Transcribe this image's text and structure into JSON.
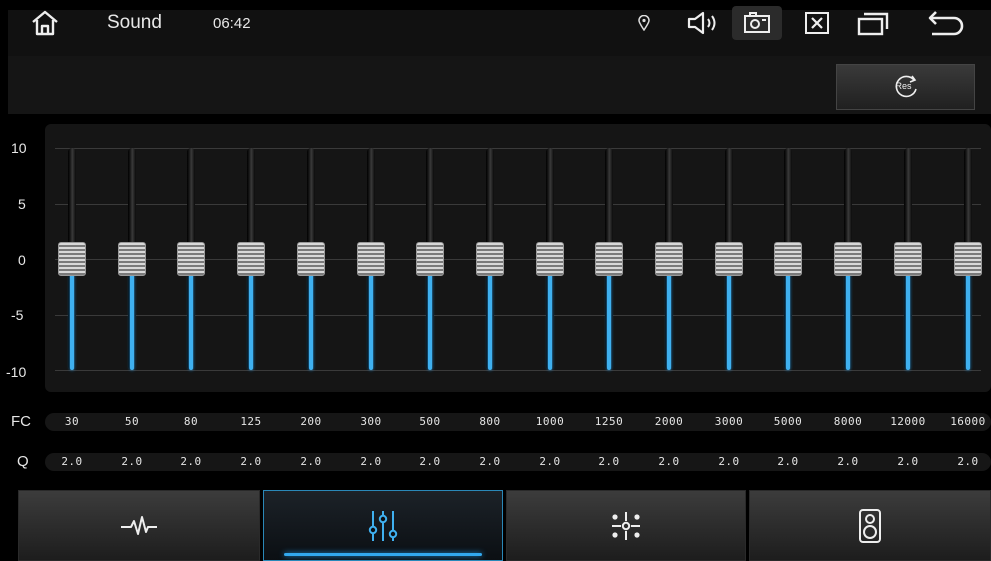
{
  "topbar": {
    "title": "Sound",
    "time": "06:42",
    "icons": [
      "home-icon",
      "location-icon",
      "volume-icon",
      "screenshot-camera-icon",
      "close-box-icon",
      "window-icon",
      "back-arrow-icon"
    ]
  },
  "reset": {
    "label": "Res",
    "icon": "reset-icon"
  },
  "eq": {
    "y_labels": [
      "10",
      "5",
      "0",
      "-5",
      "-10"
    ],
    "fc_label": "FC",
    "q_label": "Q",
    "bands": [
      {
        "fc": "30",
        "q": "2.0",
        "gain": 0
      },
      {
        "fc": "50",
        "q": "2.0",
        "gain": 0
      },
      {
        "fc": "80",
        "q": "2.0",
        "gain": 0
      },
      {
        "fc": "125",
        "q": "2.0",
        "gain": 0
      },
      {
        "fc": "200",
        "q": "2.0",
        "gain": 0
      },
      {
        "fc": "300",
        "q": "2.0",
        "gain": 0
      },
      {
        "fc": "500",
        "q": "2.0",
        "gain": 0
      },
      {
        "fc": "800",
        "q": "2.0",
        "gain": 0
      },
      {
        "fc": "1000",
        "q": "2.0",
        "gain": 0
      },
      {
        "fc": "1250",
        "q": "2.0",
        "gain": 0
      },
      {
        "fc": "2000",
        "q": "2.0",
        "gain": 0
      },
      {
        "fc": "3000",
        "q": "2.0",
        "gain": 0
      },
      {
        "fc": "5000",
        "q": "2.0",
        "gain": 0
      },
      {
        "fc": "8000",
        "q": "2.0",
        "gain": 0
      },
      {
        "fc": "12000",
        "q": "2.0",
        "gain": 0
      },
      {
        "fc": "16000",
        "q": "2.0",
        "gain": 0
      }
    ]
  },
  "tabs": [
    {
      "icon": "waveform-icon",
      "active": false
    },
    {
      "icon": "equalizer-sliders-icon",
      "active": true
    },
    {
      "icon": "sound-field-icon",
      "active": false
    },
    {
      "icon": "speaker-icon",
      "active": false
    }
  ],
  "colors": {
    "accent": "#3fb0ef",
    "background": "#000000"
  }
}
